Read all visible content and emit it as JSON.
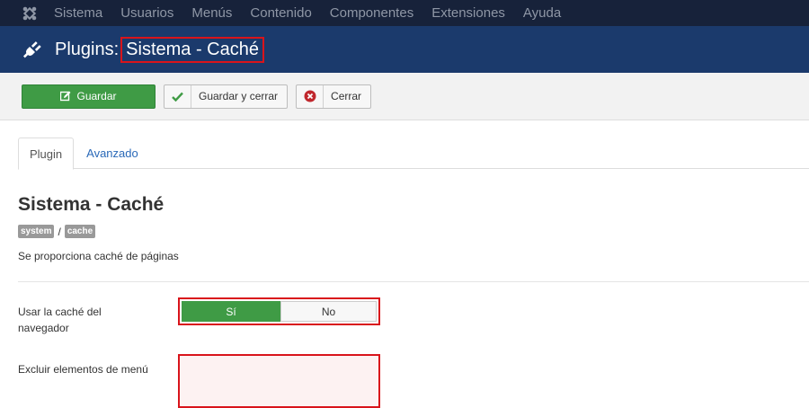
{
  "topnav": {
    "items": [
      "Sistema",
      "Usuarios",
      "Menús",
      "Contenido",
      "Componentes",
      "Extensiones",
      "Ayuda"
    ]
  },
  "titlebar": {
    "prefix": "Plugins:",
    "highlight": "Sistema - Caché"
  },
  "toolbar": {
    "save_label": "Guardar",
    "save_close_label": "Guardar y cerrar",
    "close_label": "Cerrar"
  },
  "tabs": {
    "active": "Plugin",
    "inactive": "Avanzado"
  },
  "plugin": {
    "heading": "Sistema - Caché",
    "badge_group": "system",
    "badge_separator": "/",
    "badge_element": "cache",
    "description": "Se proporciona caché de páginas"
  },
  "form": {
    "browser_cache_label": "Usar la caché del navegador",
    "yes_label": "Sí",
    "no_label": "No",
    "exclude_menu_label": "Excluir elementos de menú"
  },
  "colors": {
    "topnav_bg": "#17223a",
    "titlebar_bg": "#1b3a6c",
    "success_green": "#3f9b45",
    "highlight_red": "#d9141b",
    "link_blue": "#2a69b8"
  },
  "icons": {
    "logo": "joomla-logo-icon",
    "title": "plug-icon",
    "save": "edit-icon",
    "save_close": "checkmark-icon",
    "close": "close-circle-icon"
  }
}
